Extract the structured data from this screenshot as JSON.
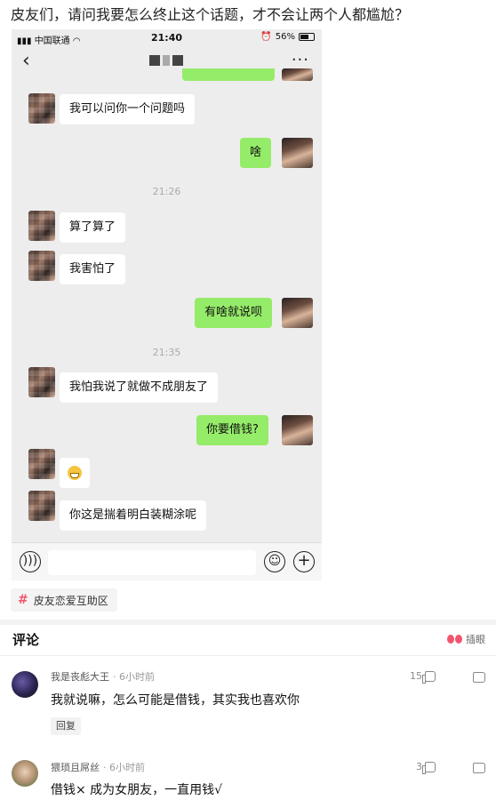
{
  "post": {
    "title": "皮友们，请问我要怎么终止这个话题，才不会让两个人都尴尬？",
    "topic_tag": "皮友恋爱互助区"
  },
  "phone": {
    "carrier": "中国联通",
    "time": "21:40",
    "battery": "56%",
    "messages": {
      "m1": "我可以问你一个问题吗",
      "m2": "啥",
      "ts1": "21:26",
      "m3": "算了算了",
      "m4": "我害怕了",
      "m5": "有啥就说呗",
      "ts2": "21:35",
      "m6": "我怕我说了就做不成朋友了",
      "m7": "你要借钱?",
      "m9": "你这是揣着明白装糊涂呢"
    }
  },
  "comments": {
    "header": "评论",
    "sort_label": "插眼",
    "items": [
      {
        "user": "我是丧彪大王",
        "time": "· 6小时前",
        "text": "我就说嘛，怎么可能是借钱，其实我也喜欢你",
        "likes": "15",
        "reply_label": "回复"
      },
      {
        "user": "猥琐且屌丝",
        "time": "· 6小时前",
        "text": "借钱× 成为女朋友，一直用钱√",
        "likes": "3"
      }
    ]
  },
  "colors": {
    "my_bubble": "#95ec69",
    "accent": "#f2556f"
  }
}
